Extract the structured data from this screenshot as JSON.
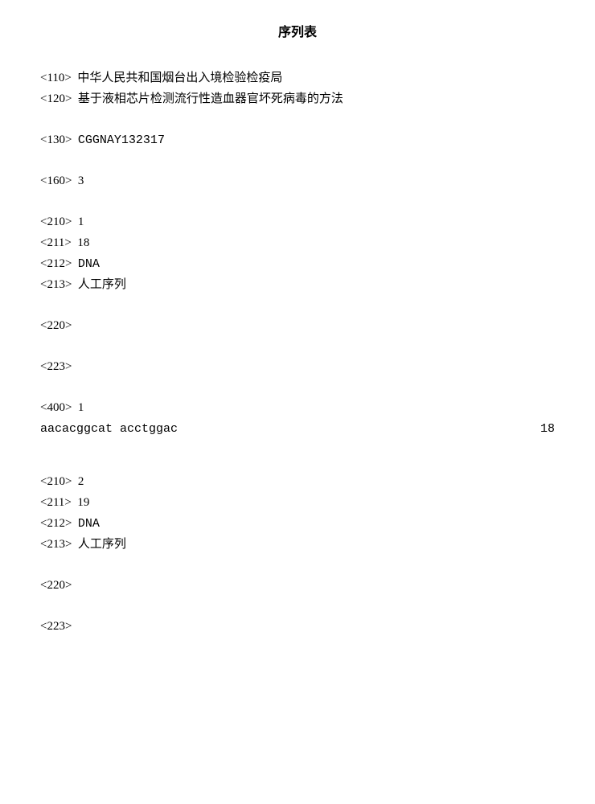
{
  "title": "序列表",
  "header": {
    "tag110": "<110>",
    "val110": "中华人民共和国烟台出入境检验检疫局",
    "tag120": "<120>",
    "val120": "基于液相芯片检测流行性造血器官坏死病毒的方法",
    "tag130": "<130>",
    "val130": "CGGNAY132317",
    "tag160": "<160>",
    "val160": "3"
  },
  "seq1": {
    "tag210": "<210>",
    "val210": "1",
    "tag211": "<211>",
    "val211": "18",
    "tag212": "<212>",
    "val212": "DNA",
    "tag213": "<213>",
    "val213": "人工序列",
    "tag220": "<220>",
    "tag223": "<223>",
    "tag400": "<400>",
    "val400": "1",
    "sequence": "aacacggcat acctggac",
    "length": "18"
  },
  "seq2": {
    "tag210": "<210>",
    "val210": "2",
    "tag211": "<211>",
    "val211": "19",
    "tag212": "<212>",
    "val212": "DNA",
    "tag213": "<213>",
    "val213": "人工序列",
    "tag220": "<220>",
    "tag223": "<223>"
  }
}
